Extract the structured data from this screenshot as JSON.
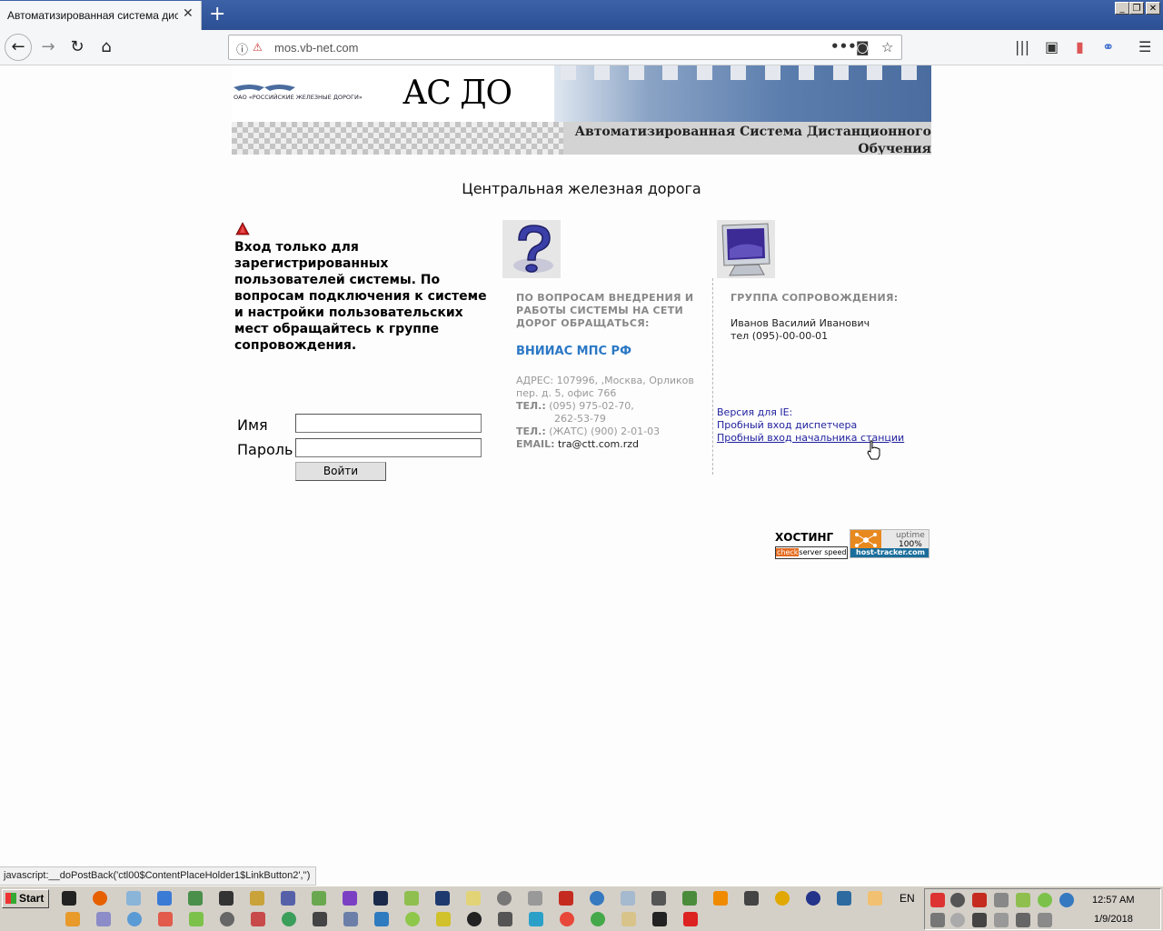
{
  "browser": {
    "tab_title": "Автоматизированная система дистанционного обучения",
    "tab_close": "✕",
    "new_tab": "+",
    "url": "mos.vb-net.com",
    "status_text": "javascript:__doPostBack('ctl00$ContentPlaceHolder1$LinkButton2','')",
    "icons": [
      "back-icon",
      "forward-icon",
      "reload-icon",
      "home-icon",
      "info-icon",
      "page-actions-icon",
      "pocket-icon",
      "bookmark-star-icon",
      "library-icon",
      "sidebar-icon",
      "menu-icon"
    ]
  },
  "header": {
    "logo_text": "ОАО «РОССИЙСКИЕ ЖЕЛЕЗНЫЕ ДОРОГИ»",
    "title": "АС ДО",
    "subtitle": "Автоматизированная Система Дистанционного Обучения"
  },
  "region": "Центральная железная дорога",
  "notice": "Вход только для зарегистрированных пользователей системы. По вопросам подключения к системе и настройки пользовательских мест обращайтесь к группе сопровождения.",
  "login": {
    "name_label": "Имя",
    "name_value": "",
    "password_label": "Пароль",
    "password_value": "",
    "button": "Войти"
  },
  "implementation": {
    "heading": "ПО ВОПРОСАМ ВНЕДРЕНИЯ И РАБОТЫ СИСТЕМЫ НА СЕТИ ДОРОГ ОБРАЩАТЬСЯ:",
    "org": "ВНИИАС МПС РФ",
    "address_label": "АДРЕС:",
    "address": "107996, ,Москва, Орликов пер. д. 5, офис 766",
    "phone_label": "ТЕЛ.:",
    "phone": "(095) 975-02-70,",
    "phone2": "262-53-79",
    "phone3_label": "ТЕЛ.:",
    "phone3": "(ЖАТС) (900) 2-01-03",
    "email_label": "EMAIL:",
    "email": "tra@ctt.com.rzd"
  },
  "support": {
    "heading": "ГРУППА СОПРОВОЖДЕНИЯ:",
    "name": "Иванов Василий Иванович",
    "phone": "тел (095)-00-00-01"
  },
  "ie_links": {
    "label": "Версия для IE:",
    "dispatcher": "Пробный вход диспетчера",
    "station_head": "Пробный вход начальника станции"
  },
  "hosting": {
    "label": "ХОСТИНГ",
    "check_a": "check",
    "check_b": "server speed",
    "uptime_label": "uptime",
    "uptime_value": "100%",
    "tracker": "host-tracker.com"
  },
  "taskbar": {
    "start": "Start",
    "lang": "EN",
    "time": "12:57 AM",
    "date": "1/9/2018"
  },
  "colors": {
    "link": "#1f1f9e",
    "org_accent": "#2b78c5",
    "tabbar": "#3d62a8"
  }
}
